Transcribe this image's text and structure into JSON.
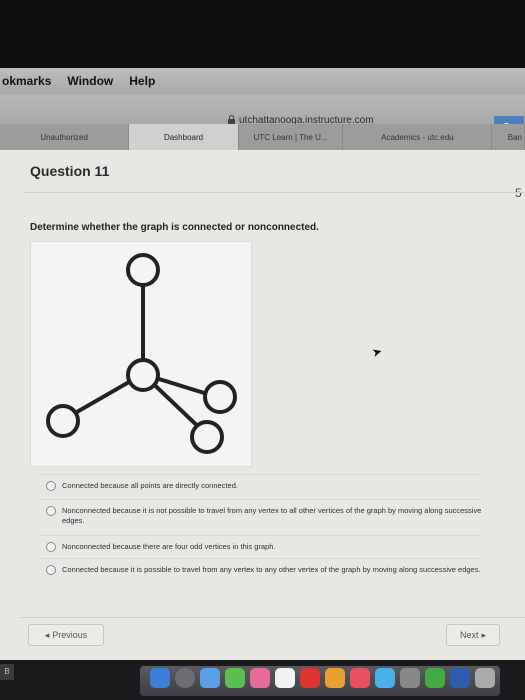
{
  "menubar": {
    "items": [
      "okmarks",
      "Window",
      "Help"
    ]
  },
  "browser": {
    "url": "utchattanooga.instructure.com",
    "tabs": [
      "Unauthorized",
      "Dashboard",
      "UTC Learn | The U...",
      "Academics - utc.edu",
      "Ban"
    ]
  },
  "question": {
    "title": "Question 11",
    "points": "5",
    "prompt": "Determine whether the graph is connected or nonconnected.",
    "answers": [
      "Connected because all points are directly connected.",
      "Nonconnected because it is not possible to travel from any vertex to all other vertices of the graph by moving along successive edges.",
      "Nonconnected because there are four odd vertices in this graph.",
      "Connected because it is possible to travel from any vertex to any other vertex of the graph by moving along successive edges."
    ]
  },
  "nav": {
    "previous": "Previous",
    "next": "Next"
  },
  "dock": {
    "badge": "B"
  },
  "graph": {
    "vertex_count": 5,
    "edge_count": 4
  },
  "colors": {
    "accent": "#4a7fc1",
    "page": "#e8e7e3"
  }
}
